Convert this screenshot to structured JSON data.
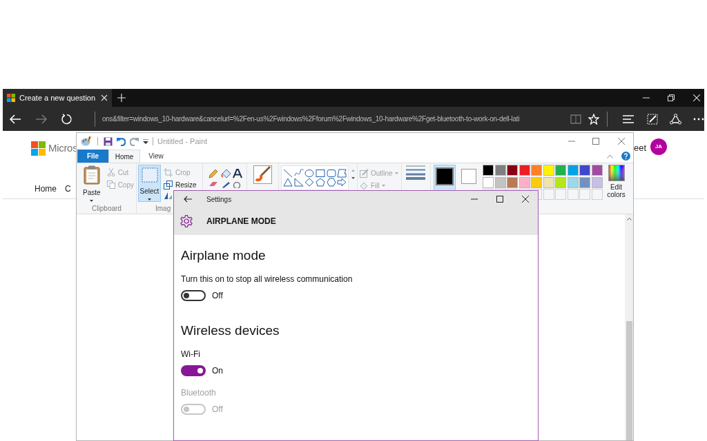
{
  "browser": {
    "tab": {
      "title": "Create a new question",
      "selected": true
    },
    "address": "ons&filter=windows_10-hardware&cancelurl=%2Fen-us%2Fwindows%2Fforum%2Fwindows_10-hardware%2Fget-bluetooth-to-work-on-dell-lati"
  },
  "webpage": {
    "logo_text": "Micros",
    "nav": [
      "Home",
      "C"
    ],
    "header_text": "eet",
    "avatar": "JA"
  },
  "paint": {
    "title": "Untitled - Paint",
    "tabs": [
      {
        "label": "File",
        "kind": "file",
        "selected": false
      },
      {
        "label": "Home",
        "kind": "tab",
        "selected": true
      },
      {
        "label": "View",
        "kind": "tab",
        "selected": false
      }
    ],
    "paste": "Paste",
    "clipboard_tools": [
      {
        "label": "Cut",
        "disabled": true
      },
      {
        "label": "Copy",
        "disabled": true
      }
    ],
    "clipboard_label": "Clipboard",
    "select": {
      "label": "Select",
      "selected": true
    },
    "image_tools": [
      {
        "label": "Crop",
        "disabled": true
      },
      {
        "label": "Resize",
        "disabled": false
      }
    ],
    "image_label": "Imag",
    "shape_options": [
      {
        "label": "Outline",
        "disabled": true
      },
      {
        "label": "Fill",
        "disabled": true
      }
    ],
    "colors": [
      {
        "selected": true,
        "color": "#000000"
      },
      {
        "selected": false,
        "color": "#ffffff"
      }
    ],
    "palette": [
      {
        "color": "#000000"
      },
      {
        "color": "#7f7f7f"
      },
      {
        "color": "#880015"
      },
      {
        "color": "#ed1c24"
      },
      {
        "color": "#ff7f27"
      },
      {
        "color": "#fff200"
      },
      {
        "color": "#22b14c"
      },
      {
        "color": "#00a2e8"
      },
      {
        "color": "#3f48cc"
      },
      {
        "color": "#a349a4"
      },
      {
        "color": "#ffffff"
      },
      {
        "color": "#c3c3c3"
      },
      {
        "color": "#b97a57"
      },
      {
        "color": "#ffaec9"
      },
      {
        "color": "#ffc90e"
      },
      {
        "color": "#efe4b0"
      },
      {
        "color": "#b5e61d"
      },
      {
        "color": "#99d9ea"
      },
      {
        "color": "#7092be"
      },
      {
        "color": "#c8bfe7"
      }
    ],
    "edit_colors": "Edit colors"
  },
  "settings": {
    "title": "Settings",
    "page": "AIRPLANE MODE",
    "sections": [
      {
        "heading": "Airplane mode",
        "items": [
          {
            "label": "Turn this on to stop all wireless communication",
            "on": false,
            "disabled": false,
            "state_text": "Off"
          }
        ]
      },
      {
        "heading": "Wireless devices",
        "items": [
          {
            "label": "Wi-Fi",
            "on": true,
            "disabled": false,
            "state_text": "On"
          },
          {
            "label": "Bluetooth",
            "on": false,
            "disabled": true,
            "state_text": "Off"
          }
        ]
      }
    ]
  }
}
